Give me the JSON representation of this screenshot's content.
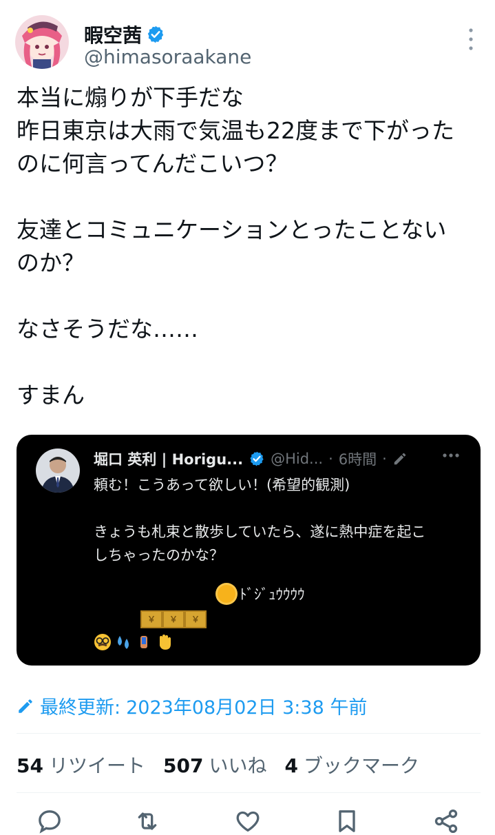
{
  "author": {
    "display_name": "暇空茜",
    "handle": "@himasoraakane",
    "verified_icon": "verified-badge-icon"
  },
  "tweet": {
    "lines": [
      "本当に煽りが下手だな",
      "昨日東京は大雨で気温も22度まで下がった",
      "のに何言ってんだこいつ？",
      "",
      "友達とコミュニケーションとったことない",
      "のか？",
      "",
      "なさそうだな……",
      "",
      "すまん"
    ]
  },
  "quote": {
    "name": "堀口 英利 | Horigu...",
    "handle": "@Hid...",
    "dot": "·",
    "time": "6時間",
    "dot2": "·",
    "body_line1": "頼む！こうあって欲しい！(希望的観測)",
    "body_line2": "",
    "body_line3": "きょうも札束と散歩していたら、遂に熱中症を起こ",
    "body_line4": "しちゃったのかな？",
    "center_text": "ﾄﾞｼﾞｭｳｳｳｳ",
    "gold_labels": [
      "￥",
      "￥",
      "￥"
    ]
  },
  "updated": {
    "label": "最終更新:",
    "datetime": "2023年08月02日 3:38 午前"
  },
  "stats": {
    "retweets_num": "54",
    "retweets_label": "リツイート",
    "likes_num": "507",
    "likes_label": "いいね",
    "bookmarks_num": "4",
    "bookmarks_label": "ブックマーク"
  },
  "colors": {
    "accent": "#1d9bf0",
    "text": "#0f1419",
    "muted": "#536471",
    "quote_bg": "#000000"
  }
}
